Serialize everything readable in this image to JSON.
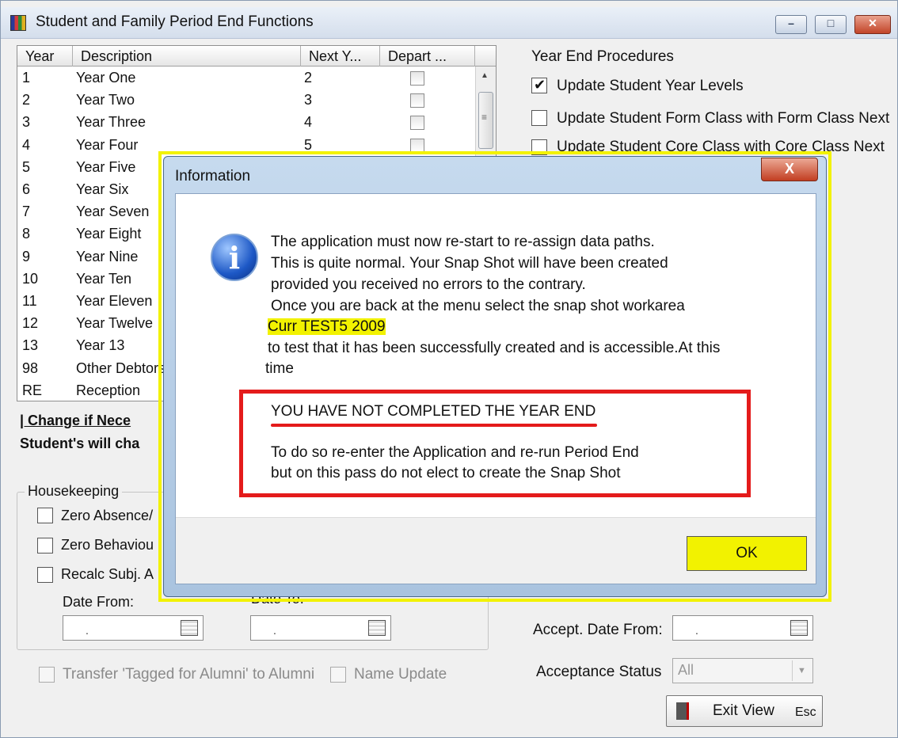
{
  "window": {
    "title": "Student and  Family Period End Functions",
    "min_glyph": "–",
    "max_glyph": "□",
    "close_glyph": "✕"
  },
  "grid": {
    "headers": [
      "Year",
      "Description",
      "Next Y...",
      "Depart ..."
    ],
    "rows": [
      {
        "year": "1",
        "desc": "Year One",
        "next": "2"
      },
      {
        "year": "2",
        "desc": "Year Two",
        "next": "3"
      },
      {
        "year": "3",
        "desc": "Year Three",
        "next": "4"
      },
      {
        "year": "4",
        "desc": "Year Four",
        "next": "5"
      },
      {
        "year": "5",
        "desc": "Year Five",
        "next": ""
      },
      {
        "year": "6",
        "desc": "Year Six",
        "next": ""
      },
      {
        "year": "7",
        "desc": "Year Seven",
        "next": ""
      },
      {
        "year": "8",
        "desc": "Year Eight",
        "next": ""
      },
      {
        "year": "9",
        "desc": "Year Nine",
        "next": ""
      },
      {
        "year": "10",
        "desc": "Year Ten",
        "next": ""
      },
      {
        "year": "11",
        "desc": "Year Eleven",
        "next": ""
      },
      {
        "year": "12",
        "desc": "Year Twelve",
        "next": ""
      },
      {
        "year": "13",
        "desc": "Year 13",
        "next": ""
      },
      {
        "year": "98",
        "desc": "Other Debtors",
        "next": ""
      },
      {
        "year": "RE",
        "desc": "Reception",
        "next": ""
      }
    ]
  },
  "change_label": "| Change if Nece",
  "students_label": "Student's will cha",
  "year_end": {
    "title": "Year End Procedures",
    "options": [
      {
        "label": "Update Student Year Levels",
        "checked": true
      },
      {
        "label": "Update Student Form Class with Form Class Next",
        "checked": false
      },
      {
        "label": "Update Student Core Class with Core Class Next",
        "checked": false
      }
    ]
  },
  "housekeeping": {
    "legend": "Housekeeping",
    "options": [
      "Zero Absence/",
      "Zero Behaviou",
      "Recalc Subj. A"
    ],
    "date_from_label": "Date From:",
    "date_to_label": "Date To:",
    "date_placeholder": ".",
    "transfer_label": "Transfer 'Tagged for Alumni' to Alumni",
    "name_update_label": "Name Update"
  },
  "acceptance": {
    "date_label": "Accept. Date  From:",
    "status_label": "Acceptance Status",
    "status_value": "All"
  },
  "exit": {
    "label": "Exit View",
    "key": "Esc"
  },
  "dialog": {
    "title": "Information",
    "close_glyph": "X",
    "icon_glyph": "i",
    "lines": [
      "The application must now re-start to re-assign data paths.",
      "This is quite normal. Your Snap Shot will have been created",
      "provided you received no errors to the contrary.",
      "Once you are back at the menu select the snap shot workarea"
    ],
    "workarea": "Curr TEST5 2009",
    "line_after": "to test that it has been successfully created and is accessible.At this",
    "line_time": "time",
    "warning": "YOU HAVE NOT COMPLETED THE YEAR END",
    "instr1": "To do so re-enter the Application and re-run Period End",
    "instr2": "but on this pass do not elect to create the Snap Shot",
    "ok_label": "OK"
  },
  "colors": {
    "highlight": "#f2f200",
    "annotation_red": "#e41b1b"
  }
}
